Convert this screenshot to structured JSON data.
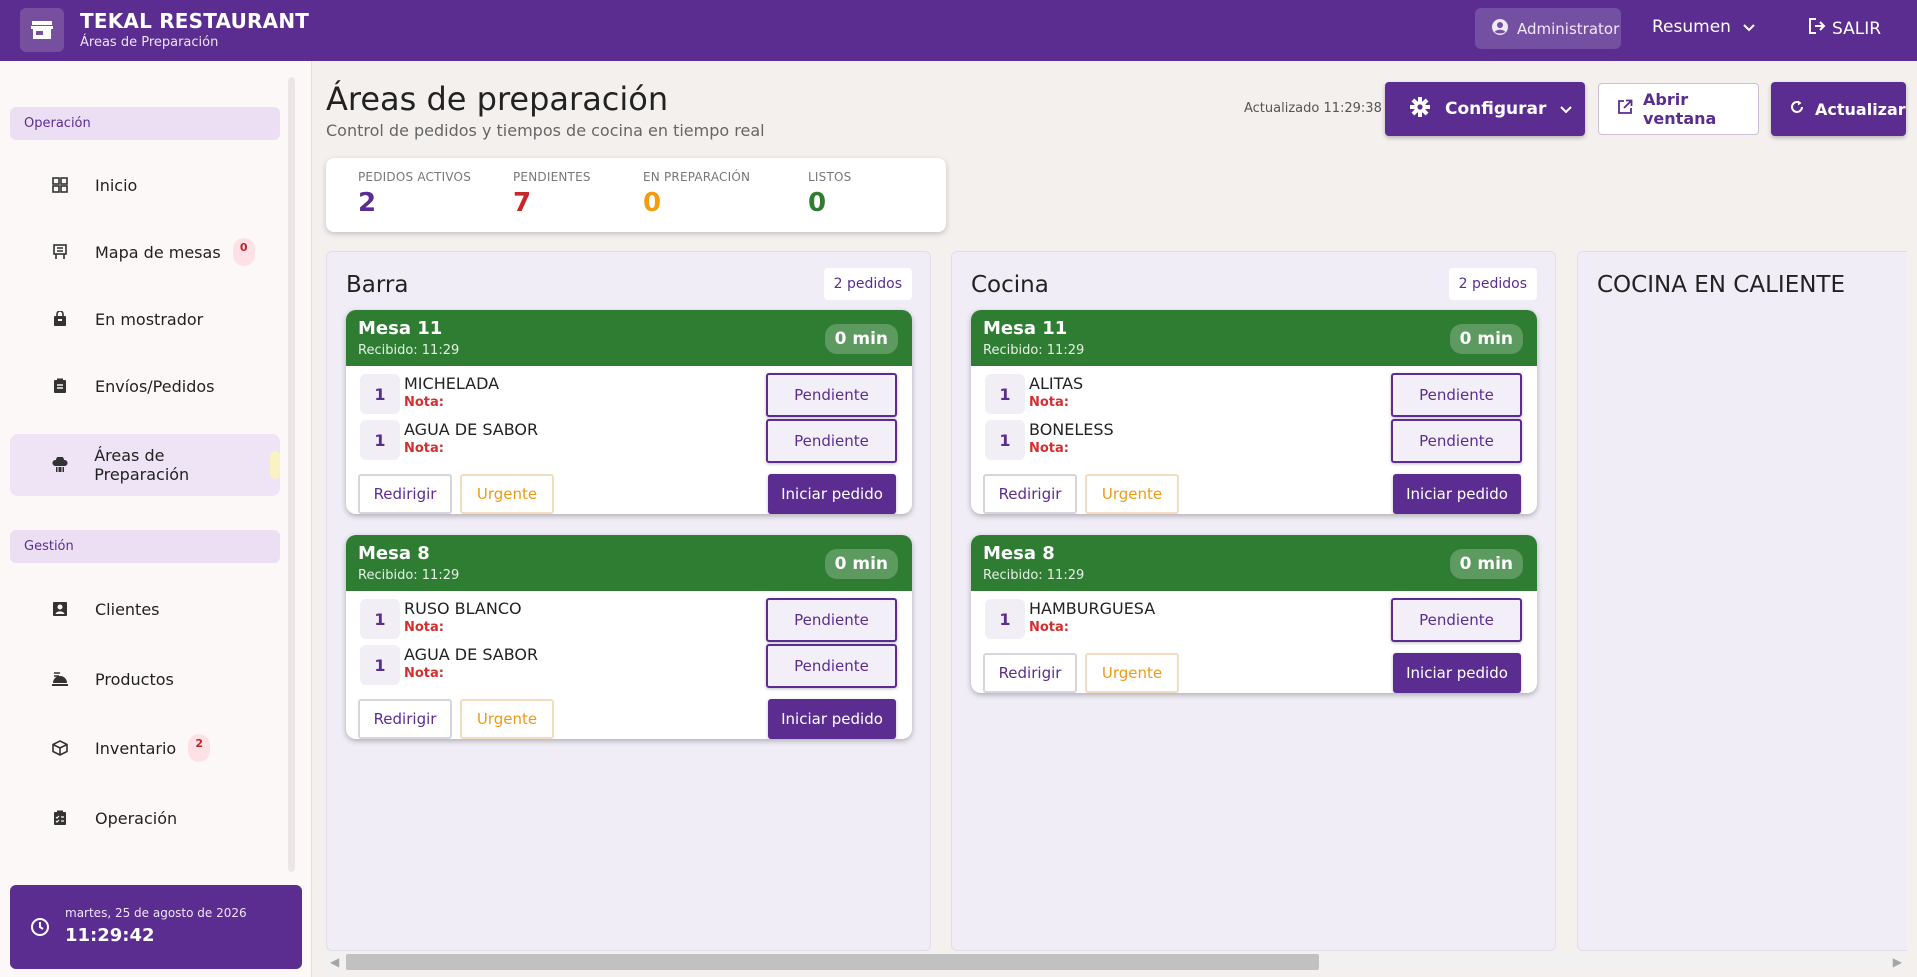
{
  "app": {
    "title": "TEKAL RESTAURANT",
    "subtitle": "Áreas de Preparación",
    "user": "Administrator",
    "summary": "Resumen",
    "logout": "SALIR"
  },
  "sidebar": {
    "sections": [
      {
        "label": "Operación"
      },
      {
        "label": "Gestión"
      }
    ],
    "items": [
      {
        "label": "Inicio",
        "icon": "grid-icon"
      },
      {
        "label": "Mapa de mesas",
        "icon": "table-map-icon",
        "badge": "0"
      },
      {
        "label": "En mostrador",
        "icon": "bag-icon"
      },
      {
        "label": "Envíos/Pedidos",
        "icon": "clipboard-icon"
      },
      {
        "label": "Áreas de Preparación",
        "icon": "chef-hat-icon",
        "active": true
      },
      {
        "label": "Clientes",
        "icon": "contact-card-icon"
      },
      {
        "label": "Productos",
        "icon": "food-tray-icon"
      },
      {
        "label": "Inventario",
        "icon": "cube-icon",
        "badge": "2"
      },
      {
        "label": "Operación",
        "icon": "task-list-icon"
      }
    ],
    "clock": {
      "date": "martes, 25 de agosto de 2026",
      "time": "11:29:42"
    }
  },
  "page": {
    "title": "Áreas de preparación",
    "subtitle": "Control de pedidos y tiempos de cocina en tiempo real",
    "updated": "Actualizado 11:29:38",
    "buttons": {
      "configure": "Configurar",
      "open_window": "Abrir ventana",
      "refresh": "Actualizar"
    }
  },
  "stats": [
    {
      "label": "PEDIDOS ACTIVOS",
      "value": "2",
      "color": "#5b2d90"
    },
    {
      "label": "PENDIENTES",
      "value": "7",
      "color": "#c62828"
    },
    {
      "label": "EN PREPARACIÓN",
      "value": "0",
      "color": "#f39c12"
    },
    {
      "label": "LISTOS",
      "value": "0",
      "color": "#2e7d32"
    }
  ],
  "areas": [
    {
      "name": "Barra",
      "count": "2 pedidos",
      "orders": [
        {
          "table": "Mesa 11",
          "received": "Recibido: 11:29",
          "timer": "0 min",
          "items": [
            {
              "qty": "1",
              "name": "MICHELADA",
              "note": "Nota:",
              "status": "Pendiente"
            },
            {
              "qty": "1",
              "name": "AGUA DE SABOR",
              "note": "Nota:",
              "status": "Pendiente"
            }
          ],
          "actions": {
            "redirect": "Redirigir",
            "urgent": "Urgente",
            "start": "Iniciar pedido"
          }
        },
        {
          "table": "Mesa 8",
          "received": "Recibido: 11:29",
          "timer": "0 min",
          "items": [
            {
              "qty": "1",
              "name": "RUSO BLANCO",
              "note": "Nota:",
              "status": "Pendiente"
            },
            {
              "qty": "1",
              "name": "AGUA DE SABOR",
              "note": "Nota:",
              "status": "Pendiente"
            }
          ],
          "actions": {
            "redirect": "Redirigir",
            "urgent": "Urgente",
            "start": "Iniciar pedido"
          }
        }
      ]
    },
    {
      "name": "Cocina",
      "count": "2 pedidos",
      "orders": [
        {
          "table": "Mesa 11",
          "received": "Recibido: 11:29",
          "timer": "0 min",
          "items": [
            {
              "qty": "1",
              "name": "ALITAS",
              "note": "Nota:",
              "status": "Pendiente"
            },
            {
              "qty": "1",
              "name": "BONELESS",
              "note": "Nota:",
              "status": "Pendiente"
            }
          ],
          "actions": {
            "redirect": "Redirigir",
            "urgent": "Urgente",
            "start": "Iniciar pedido"
          }
        },
        {
          "table": "Mesa 8",
          "received": "Recibido: 11:29",
          "timer": "0 min",
          "items": [
            {
              "qty": "1",
              "name": "HAMBURGUESA",
              "note": "Nota:",
              "status": "Pendiente"
            }
          ],
          "actions": {
            "redirect": "Redirigir",
            "urgent": "Urgente",
            "start": "Iniciar pedido"
          }
        }
      ]
    },
    {
      "name": "COCINA EN CALIENTE",
      "orders": []
    }
  ],
  "colors": {
    "brand": "#5b2d90",
    "order_header": "#2e7d32",
    "note": "#d32f2f",
    "urgent": "#f09a14"
  }
}
